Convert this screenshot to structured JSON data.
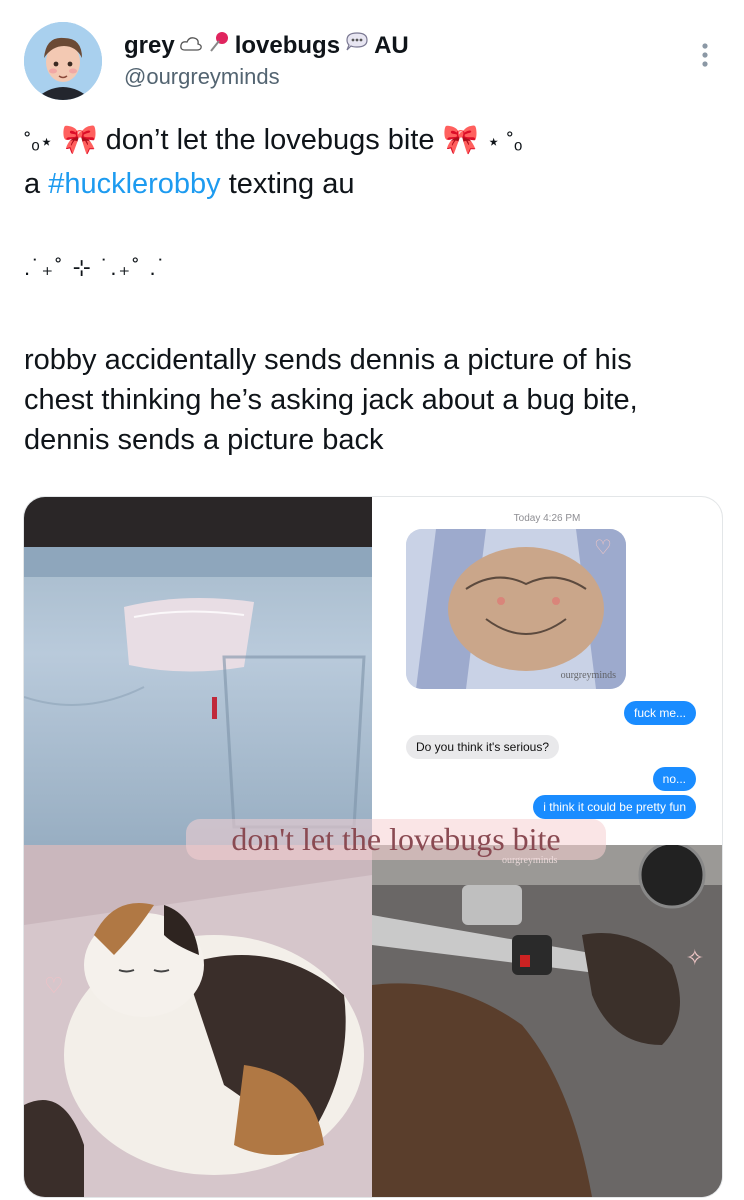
{
  "author": {
    "name": "grey",
    "name_suffix": "lovebugs",
    "name_tail": "AU",
    "handle": "@ourgreyminds",
    "avatar_icon": "cartoon-avatar",
    "name_icons": [
      "cloud-icon",
      "pushpin-icon",
      "thought-bubble-icon"
    ]
  },
  "tweet": {
    "title_line_start": "don’t let the lovebugs bite",
    "line2_prefix": "a ",
    "hashtag": "#hucklerobby",
    "line2_suffix": " texting au",
    "sparkles": ".˙₊˚ ⊹ ˙.₊˚ .˙",
    "body_lines": [
      "robby accidentally sends dennis a picture of his",
      "chest thinking he’s asking jack about a bug bite,",
      "dennis sends a picture back"
    ],
    "decoration_icons": [
      "bow-icon",
      "star-icon"
    ]
  },
  "media": {
    "chat": {
      "timestamp": "Today 4:26 PM",
      "messages": [
        {
          "from": "me",
          "text": "fuck me..."
        },
        {
          "from": "them",
          "text": "Do you think it's serious?"
        },
        {
          "from": "me",
          "text": "no..."
        },
        {
          "from": "me",
          "text": "i think it could be pretty fun"
        }
      ],
      "sketch_watermark": "ourgreyminds"
    },
    "caption": "don't let the lovebugs bite",
    "caption_watermark": "ourgreyminds"
  },
  "colors": {
    "link": "#1d9bf0",
    "handle": "#536471",
    "imessage_blue": "#1a8cff",
    "caption_text": "#8a4a52"
  }
}
